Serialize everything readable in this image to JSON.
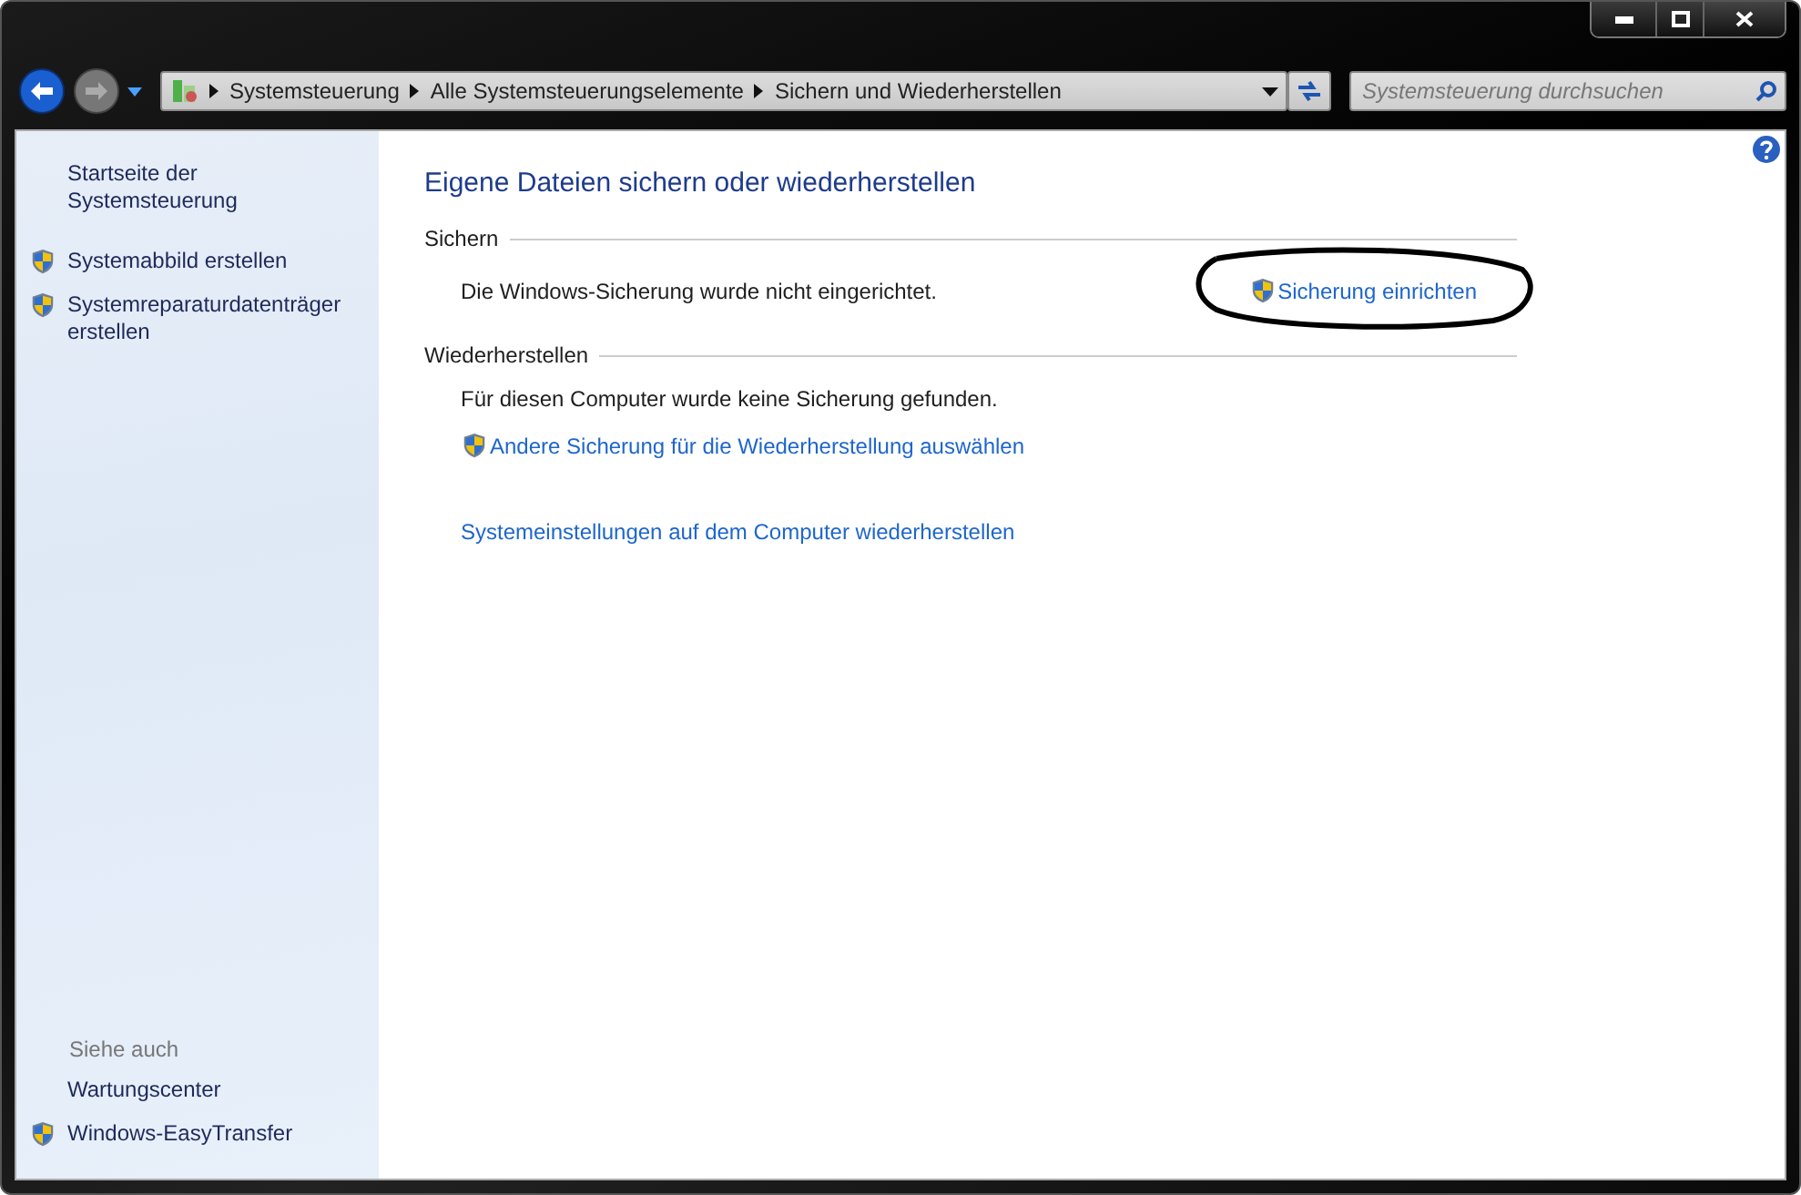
{
  "breadcrumb": [
    "Systemsteuerung",
    "Alle Systemsteuerungselemente",
    "Sichern und Wiederherstellen"
  ],
  "search": {
    "placeholder": "Systemsteuerung durchsuchen"
  },
  "sidebar": {
    "items": [
      {
        "label": "Startseite der Systemsteuerung",
        "shield": false
      },
      {
        "label": "Systemabbild erstellen",
        "shield": true
      },
      {
        "label": "Systemreparaturdatenträger erstellen",
        "shield": true
      }
    ],
    "see_also_heading": "Siehe auch",
    "see_also": [
      {
        "label": "Wartungscenter",
        "shield": false
      },
      {
        "label": "Windows-EasyTransfer",
        "shield": true
      }
    ]
  },
  "title": "Eigene Dateien sichern oder wiederherstellen",
  "sections": [
    {
      "heading": "Sichern",
      "rows": [
        {
          "kind": "status",
          "text": "Die Windows-Sicherung wurde nicht eingerichtet.",
          "action": {
            "label": "Sicherung einrichten",
            "shield": true,
            "circled": true
          }
        }
      ]
    },
    {
      "heading": "Wiederherstellen",
      "rows": [
        {
          "kind": "text",
          "text": "Für diesen Computer wurde keine Sicherung gefunden."
        },
        {
          "kind": "link",
          "text": "Andere Sicherung für die Wiederherstellung auswählen",
          "shield": true
        },
        {
          "kind": "gap"
        },
        {
          "kind": "link",
          "text": "Systemeinstellungen auf dem Computer wiederherstellen",
          "shield": false
        }
      ]
    }
  ]
}
